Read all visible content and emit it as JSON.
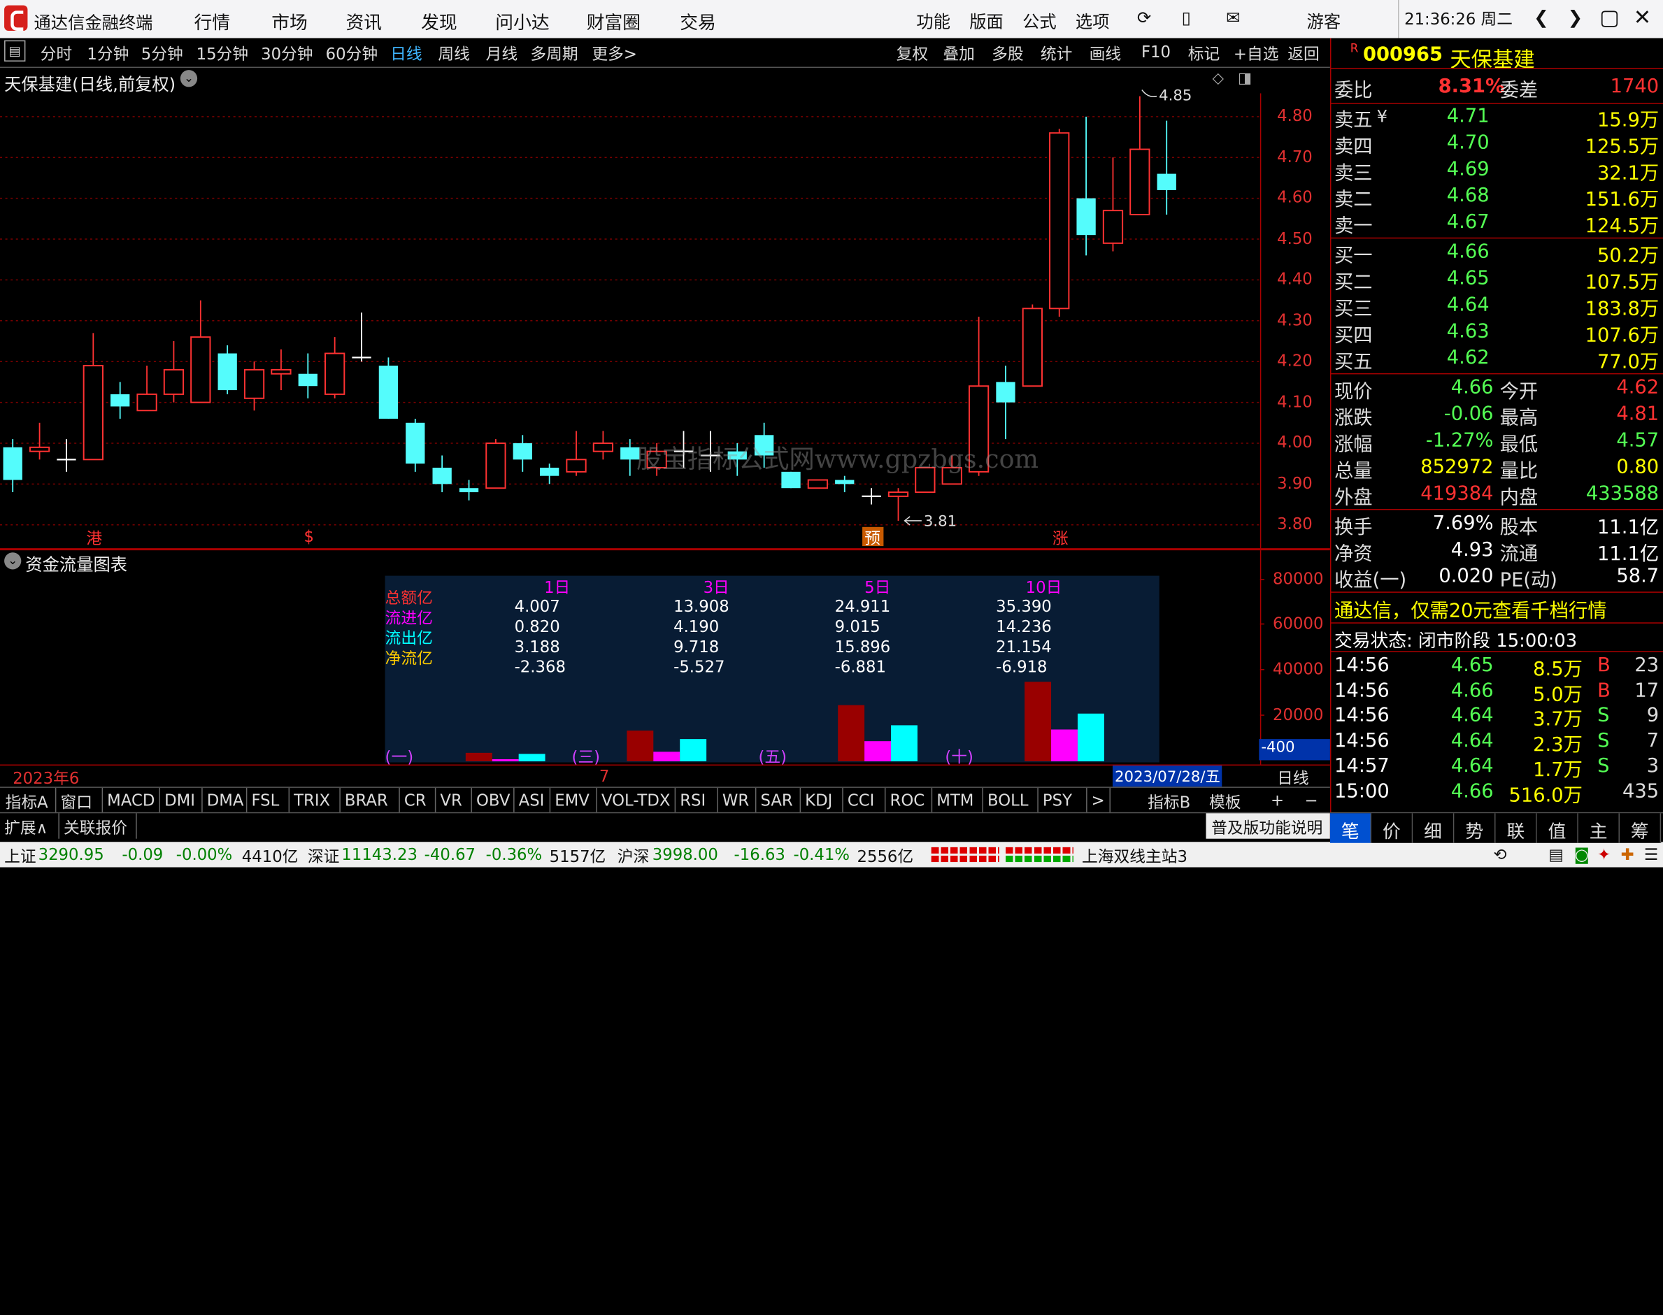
{
  "app": {
    "title": "通达信金融终端",
    "menu": [
      "行情",
      "市场",
      "资讯",
      "发现",
      "问小达",
      "财富圈",
      "交易"
    ],
    "right_menu": [
      "功能",
      "版面",
      "公式",
      "选项"
    ],
    "user": "游客",
    "clock": "21:36:26 周二"
  },
  "toolbar": {
    "periods": [
      "分时",
      "1分钟",
      "5分钟",
      "15分钟",
      "30分钟",
      "60分钟",
      "日线",
      "周线",
      "月线",
      "多周期",
      "更多>"
    ],
    "actions": [
      "复权",
      "叠加",
      "多股",
      "统计",
      "画线",
      "F10",
      "标记",
      "+自选",
      "返回"
    ]
  },
  "chart": {
    "title": "天保基建(日线,前复权)",
    "high_label": "4.85",
    "low_label": "3.81",
    "watermark": "股宝指标公式网www.gpzbgs.com",
    "y_ticks": [
      "4.80",
      "4.70",
      "4.60",
      "4.50",
      "4.40",
      "4.30",
      "4.20",
      "4.10",
      "4.00",
      "3.90",
      "3.80"
    ],
    "markers": [
      {
        "text": "港"
      },
      {
        "text": "$"
      },
      {
        "text": "预"
      },
      {
        "text": "涨"
      }
    ],
    "candles": [
      [
        3.99,
        3.91,
        4.01,
        3.88
      ],
      [
        3.98,
        3.99,
        4.05,
        3.96
      ],
      [
        3.96,
        3.96,
        4.01,
        3.93
      ],
      [
        3.96,
        4.19,
        4.27,
        3.96
      ],
      [
        4.12,
        4.09,
        4.15,
        4.06
      ],
      [
        4.08,
        4.12,
        4.19,
        4.08
      ],
      [
        4.12,
        4.18,
        4.25,
        4.1
      ],
      [
        4.1,
        4.26,
        4.35,
        4.1
      ],
      [
        4.22,
        4.13,
        4.24,
        4.12
      ],
      [
        4.11,
        4.18,
        4.2,
        4.08
      ],
      [
        4.17,
        4.18,
        4.23,
        4.13
      ],
      [
        4.17,
        4.14,
        4.22,
        4.11
      ],
      [
        4.12,
        4.22,
        4.26,
        4.11
      ],
      [
        4.21,
        4.21,
        4.32,
        4.2
      ],
      [
        4.19,
        4.06,
        4.21,
        4.06
      ],
      [
        4.05,
        3.95,
        4.06,
        3.93
      ],
      [
        3.94,
        3.9,
        3.97,
        3.88
      ],
      [
        3.89,
        3.88,
        3.91,
        3.86
      ],
      [
        3.89,
        4.0,
        4.01,
        3.89
      ],
      [
        4.0,
        3.96,
        4.02,
        3.93
      ],
      [
        3.94,
        3.92,
        3.95,
        3.9
      ],
      [
        3.93,
        3.96,
        4.03,
        3.92
      ],
      [
        3.98,
        4.0,
        4.03,
        3.96
      ],
      [
        3.99,
        3.96,
        4.01,
        3.92
      ],
      [
        3.94,
        3.98,
        4.0,
        3.92
      ],
      [
        3.98,
        3.98,
        4.03,
        3.94
      ],
      [
        3.97,
        3.97,
        4.03,
        3.93
      ],
      [
        3.98,
        3.96,
        4.0,
        3.92
      ],
      [
        4.02,
        3.97,
        4.05,
        3.94
      ],
      [
        3.93,
        3.89,
        3.93,
        3.89
      ],
      [
        3.89,
        3.91,
        3.91,
        3.89
      ],
      [
        3.91,
        3.9,
        3.92,
        3.88
      ],
      [
        3.87,
        3.87,
        3.89,
        3.85
      ],
      [
        3.87,
        3.88,
        3.89,
        3.81
      ],
      [
        3.88,
        3.94,
        3.94,
        3.88
      ],
      [
        3.9,
        3.94,
        3.97,
        3.9
      ],
      [
        3.93,
        4.14,
        4.31,
        3.92
      ],
      [
        4.15,
        4.1,
        4.19,
        4.01
      ],
      [
        4.14,
        4.33,
        4.34,
        4.14
      ],
      [
        4.33,
        4.76,
        4.77,
        4.31
      ],
      [
        4.6,
        4.51,
        4.8,
        4.46
      ],
      [
        4.49,
        4.57,
        4.7,
        4.47
      ],
      [
        4.56,
        4.72,
        4.85,
        4.56
      ],
      [
        4.66,
        4.62,
        4.79,
        4.56
      ]
    ]
  },
  "flow": {
    "title": "资金流量图表",
    "y_ticks": [
      "80000",
      "60000",
      "40000",
      "20000"
    ],
    "current": "-400",
    "row_labels": [
      "总额亿",
      "流进亿",
      "流出亿",
      "净流亿"
    ],
    "cols": [
      {
        "h": "1日",
        "v": [
          "4.007",
          "0.820",
          "3.188",
          "-2.368"
        ]
      },
      {
        "h": "3日",
        "v": [
          "13.908",
          "4.190",
          "9.718",
          "-5.527"
        ]
      },
      {
        "h": "5日",
        "v": [
          "24.911",
          "9.015",
          "15.896",
          "-6.881"
        ]
      },
      {
        "h": "10日",
        "v": [
          "35.390",
          "14.236",
          "21.154",
          "-6.918"
        ]
      }
    ],
    "bar_labels": [
      "(一)",
      "(三)",
      "(五)",
      "(十)"
    ],
    "bars": [
      [
        4.007,
        0.82,
        3.188
      ],
      [
        13.908,
        4.19,
        9.718
      ],
      [
        24.911,
        9.015,
        15.896
      ],
      [
        35.39,
        14.236,
        21.154
      ]
    ]
  },
  "xaxis": {
    "left": "2023年6",
    "mid": "7",
    "date": "2023/07/28/五",
    "period": "日线"
  },
  "tabs1": [
    "指标A",
    "窗口",
    "MACD",
    "DMI",
    "DMA",
    "FSL",
    "TRIX",
    "BRAR",
    "CR",
    "VR",
    "OBV",
    "ASI",
    "EMV",
    "VOL-TDX",
    "RSI",
    "WR",
    "SAR",
    "KDJ",
    "CCI",
    "ROC",
    "MTM",
    "BOLL",
    "PSY",
    ">"
  ],
  "tabs1_right": [
    "指标B",
    "模板",
    "+",
    "−"
  ],
  "tabs2": [
    "扩展∧",
    "关联报价"
  ],
  "tabs2_right": "普及版功能说明",
  "quote": {
    "code": "000965",
    "name": "天保基建",
    "r": "R",
    "weibi": {
      "l": "委比",
      "v": "8.31%",
      "l2": "委差",
      "v2": "1740"
    },
    "sells": [
      {
        "l": "卖五",
        "p": "4.71",
        "v": "15.9万"
      },
      {
        "l": "卖四",
        "p": "4.70",
        "v": "125.5万"
      },
      {
        "l": "卖三",
        "p": "4.69",
        "v": "32.1万"
      },
      {
        "l": "卖二",
        "p": "4.68",
        "v": "151.6万"
      },
      {
        "l": "卖一",
        "p": "4.67",
        "v": "124.5万"
      }
    ],
    "buys": [
      {
        "l": "买一",
        "p": "4.66",
        "v": "50.2万"
      },
      {
        "l": "买二",
        "p": "4.65",
        "v": "107.5万"
      },
      {
        "l": "买三",
        "p": "4.64",
        "v": "183.8万"
      },
      {
        "l": "买四",
        "p": "4.63",
        "v": "107.6万"
      },
      {
        "l": "买五",
        "p": "4.62",
        "v": "77.0万"
      }
    ],
    "stats": [
      {
        "l": "现价",
        "v": "4.66",
        "l2": "今开",
        "v2": "4.62"
      },
      {
        "l": "涨跌",
        "v": "-0.06",
        "l2": "最高",
        "v2": "4.81"
      },
      {
        "l": "涨幅",
        "v": "-1.27%",
        "l2": "最低",
        "v2": "4.57"
      },
      {
        "l": "总量",
        "v": "852972",
        "l2": "量比",
        "v2": "0.80"
      },
      {
        "l": "外盘",
        "v": "419384",
        "l2": "内盘",
        "v2": "433588"
      }
    ],
    "stats2": [
      {
        "l": "换手",
        "v": "7.69%",
        "l2": "股本",
        "v2": "11.1亿"
      },
      {
        "l": "净资",
        "v": "4.93",
        "l2": "流通",
        "v2": "11.1亿"
      },
      {
        "l": "收益(一)",
        "v": "0.020",
        "l2": "PE(动)",
        "v2": "58.7"
      }
    ],
    "ad": "通达信，仅需20元查看千档行情",
    "trade_status": "交易状态: 闭市阶段 15:00:03",
    "ticks": [
      {
        "t": "14:56",
        "p": "4.65",
        "v": "8.5万",
        "s": "B",
        "n": "23"
      },
      {
        "t": "14:56",
        "p": "4.66",
        "v": "5.0万",
        "s": "B",
        "n": "17"
      },
      {
        "t": "14:56",
        "p": "4.64",
        "v": "3.7万",
        "s": "S",
        "n": "9"
      },
      {
        "t": "14:56",
        "p": "4.64",
        "v": "2.3万",
        "s": "S",
        "n": "7"
      },
      {
        "t": "14:57",
        "p": "4.64",
        "v": "1.7万",
        "s": "S",
        "n": "3"
      },
      {
        "t": "15:00",
        "p": "4.66",
        "v": "516.0万",
        "s": "",
        "n": "435"
      }
    ],
    "bottom_tabs": [
      "笔",
      "价",
      "细",
      "势",
      "联",
      "值",
      "主",
      "筹"
    ]
  },
  "status": {
    "sh_label": "上证",
    "sh_val": "3290.95",
    "sh_chg": "-0.09",
    "sh_pct": "-0.00%",
    "sh_amt": "4410亿",
    "sz_label": "深证",
    "sz_val": "11143.23",
    "sz_chg": "-40.67",
    "sz_pct": "-0.36%",
    "sz_amt": "5157亿",
    "hs_label": "沪深",
    "hs_val": "3998.00",
    "hs_chg": "-16.63",
    "hs_pct": "-0.41%",
    "hs_amt": "2556亿",
    "server": "上海双线主站3"
  },
  "colors": {
    "up": "#ff3232",
    "down": "#54fcfc",
    "bg": "#000000",
    "grid": "#7a0000",
    "flow_total": "#990000",
    "flow_in": "#ff00ff",
    "flow_out": "#00ffff"
  }
}
